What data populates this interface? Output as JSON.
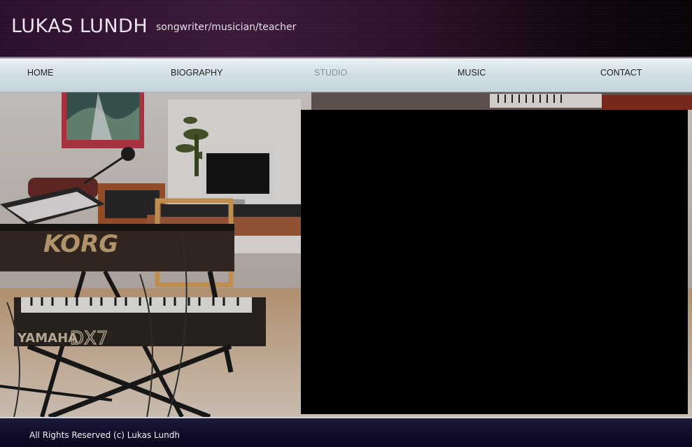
{
  "header": {
    "title": "LUKAS LUNDH",
    "tagline": "songwriter/musician/teacher"
  },
  "nav": {
    "items": [
      {
        "label": "HOME",
        "active": false
      },
      {
        "label": "BIOGRAPHY",
        "active": false
      },
      {
        "label": "STUDIO",
        "active": true
      },
      {
        "label": "MUSIC",
        "active": false
      },
      {
        "label": "CONTACT",
        "active": false
      }
    ]
  },
  "main": {
    "photo_brand_top": "KORG",
    "photo_brand_bottom": "YAMAHA DX7"
  },
  "footer": {
    "copyright": "All Rights Reserved (c) Lukas Lundh"
  },
  "colors": {
    "header_bg": "#2a0f2c",
    "nav_bg": "#d2dfe6",
    "active_nav": "#8a9396",
    "footer_bg": "#0e0c26"
  }
}
